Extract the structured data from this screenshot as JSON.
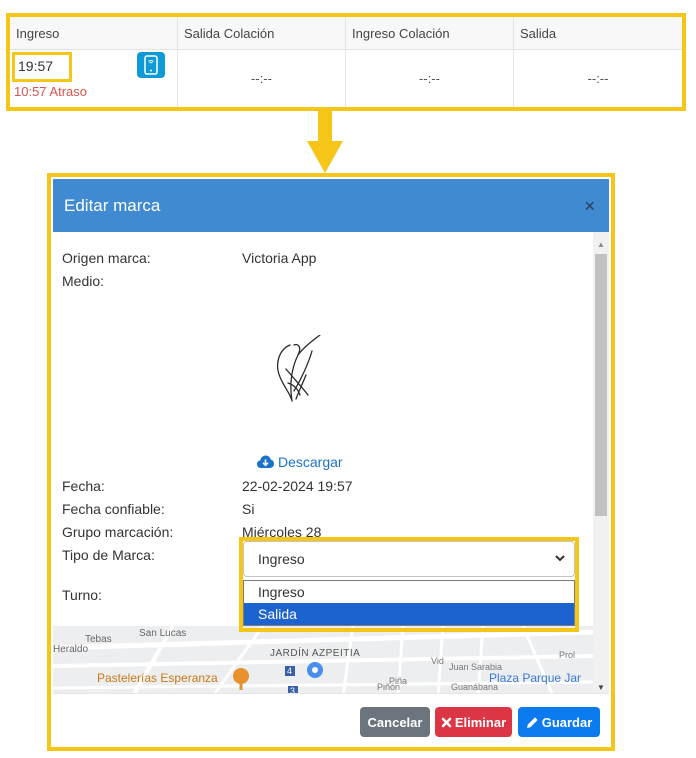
{
  "table": {
    "headers": [
      "Ingreso",
      "Salida Colación",
      "Ingreso Colación",
      "Salida"
    ],
    "ingreso_time": "19:57",
    "ingreso_status": "10:57 Atraso",
    "empty_cells": [
      "--:--",
      "--:--",
      "--:--"
    ],
    "device_icon": "mobile-phone-icon"
  },
  "modal": {
    "title": "Editar marca",
    "close_label": "×",
    "fields": {
      "origen_label": "Origen marca:",
      "origen_value": "Victoria App",
      "medio_label": "Medio:",
      "fecha_label": "Fecha:",
      "fecha_value": "22-02-2024 19:57",
      "fecha_confiable_label": "Fecha confiable:",
      "fecha_confiable_value": "Si",
      "grupo_label": "Grupo marcación:",
      "grupo_value": "Miércoles 28",
      "tipo_label": "Tipo de Marca:",
      "turno_label": "Turno:"
    },
    "download_label": "Descargar",
    "download_icon": "cloud-download-icon",
    "tipo_select": {
      "selected": "Ingreso",
      "options": [
        "Ingreso",
        "Salida"
      ],
      "highlighted": "Salida"
    },
    "map_labels": {
      "street1": "San Lucas",
      "street2": "Tebas",
      "district": "JARDÍN AZPEITIA",
      "place1": "Pastelerías Esperanza",
      "place2": "Plaza Parque Jar",
      "street3": "Heraldo",
      "badge1": "4",
      "badge2": "3",
      "street4": "Piña",
      "street5": "Piñón",
      "street6": "Guanábana",
      "street7": "Juan Sarabia",
      "street8": "Vid",
      "street9": "Prol"
    },
    "footer": {
      "cancel_label": "Cancelar",
      "delete_label": "Eliminar",
      "save_label": "Guardar"
    }
  },
  "colors": {
    "highlight_border": "#f5c518",
    "modal_header": "#3f8ad0",
    "late_text": "#d9534f",
    "cancel_button": "#6c757d",
    "delete_button": "#dc3545",
    "save_button": "#0d7bf0",
    "option_highlight": "#1d63cf"
  }
}
